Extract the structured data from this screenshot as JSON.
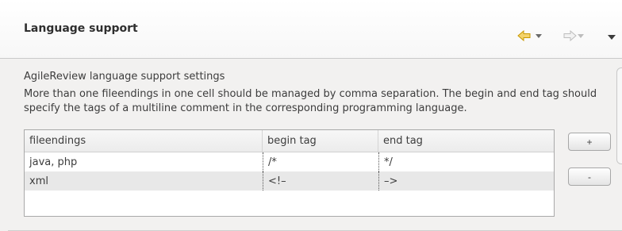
{
  "header": {
    "title": "Language support",
    "nav": {
      "back_icon": "back-arrow-icon",
      "forward_icon": "forward-arrow-icon",
      "menu_icon": "view-menu-icon"
    },
    "accent": "#e5b300"
  },
  "content": {
    "section_label": "AgileReview language support settings",
    "description": "More than one fileendings in one cell should be managed by comma separation. The begin and end tag should specify the tags of a multiline comment in the corresponding programming language."
  },
  "table": {
    "columns": [
      "fileendings",
      "begin tag",
      "end tag"
    ],
    "rows": [
      [
        "java, php",
        "/*",
        "*/"
      ],
      [
        "xml",
        "<!–",
        "–>"
      ]
    ]
  },
  "buttons": {
    "add_label": "+",
    "remove_label": "-"
  }
}
